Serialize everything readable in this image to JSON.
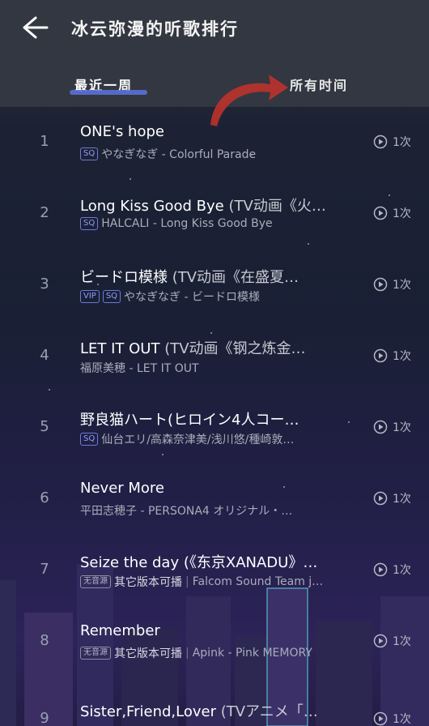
{
  "header": {
    "title": "冰云弥漫的听歌排行",
    "tabs": [
      {
        "label": "最近一周",
        "active": true
      },
      {
        "label": "所有时间",
        "active": false
      }
    ]
  },
  "colors": {
    "accent": "#5b6fd6",
    "badge": "#8f9dff",
    "arrow": "#c0392b"
  },
  "songs": [
    {
      "rank": "1",
      "title": "ONE's hope",
      "title_suffix": "",
      "badges": [
        "SQ"
      ],
      "subtitle": "やなぎなぎ - Colorful Parade",
      "plays": "1次"
    },
    {
      "rank": "2",
      "title": "Long Kiss Good Bye",
      "title_suffix": " (TV动画《火…",
      "badges": [
        "SQ"
      ],
      "subtitle": "HALCALI - Long Kiss Good Bye",
      "plays": "1次"
    },
    {
      "rank": "3",
      "title": "ビードロ模様",
      "title_suffix": " (TV动画《在盛夏…",
      "badges": [
        "VIP",
        "SQ"
      ],
      "subtitle": "やなぎなぎ - ビードロ模様",
      "plays": "1次"
    },
    {
      "rank": "4",
      "title": "LET IT OUT",
      "title_suffix": " (TV动画《钢之炼金…",
      "badges": [],
      "subtitle": "福原美穂 - LET IT OUT",
      "plays": "1次"
    },
    {
      "rank": "5",
      "title": "野良猫ハート(ヒロイン4人コー…",
      "title_suffix": "",
      "badges": [
        "SQ"
      ],
      "subtitle": "仙台エリ/高森奈津美/浅川悠/種崎敦…",
      "plays": "1次"
    },
    {
      "rank": "6",
      "title": "Never More",
      "title_suffix": "",
      "badges": [],
      "subtitle": "平田志穂子 - PERSONA4 オリジナル・…",
      "plays": "1次"
    },
    {
      "rank": "7",
      "title": "Seize the day (《东京XANADU》…",
      "title_suffix": "",
      "badges": [
        "无音源"
      ],
      "subtitle_strong": "其它版本可播",
      "subtitle": "Falcom Sound Team j…",
      "plays": "1次"
    },
    {
      "rank": "8",
      "title": "Remember",
      "title_suffix": "",
      "badges": [
        "无音源"
      ],
      "subtitle_strong": "其它版本可播",
      "subtitle": "Apink - Pink MEMORY",
      "plays": "1次"
    },
    {
      "rank": "9",
      "title": "Sister,Friend,Lover",
      "title_suffix": " (TVアニメ「…",
      "badges": [],
      "subtitle": "",
      "plays": "1次"
    }
  ]
}
